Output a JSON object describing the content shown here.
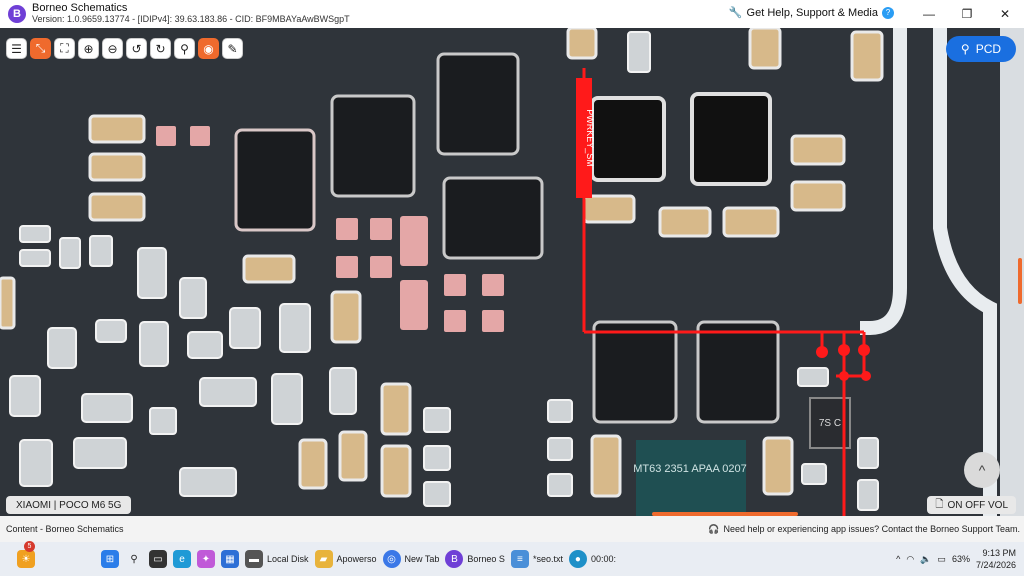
{
  "window": {
    "app_name": "Borneo Schematics",
    "version_line": "Version: 1.0.9659.13774 - [IDIPv4]: 39.63.183.86 - CID: BF9MBAYaAwBWSgpT",
    "help_link": "Get Help, Support & Media",
    "logo_letter": "B",
    "minimize": "—",
    "maximize": "❐",
    "close": "✕"
  },
  "toolbar": {
    "tools": [
      {
        "icon": "list-icon",
        "glyph": "☰"
      },
      {
        "icon": "collapse-icon",
        "glyph": "⤡"
      },
      {
        "icon": "fullscreen-icon",
        "glyph": "⛶"
      },
      {
        "icon": "zoom-in-icon",
        "glyph": "⊕"
      },
      {
        "icon": "zoom-out-icon",
        "glyph": "⊖"
      },
      {
        "icon": "rotate-left-icon",
        "glyph": "↺"
      },
      {
        "icon": "rotate-right-icon",
        "glyph": "↻"
      },
      {
        "icon": "search-icon",
        "glyph": "⚲"
      },
      {
        "icon": "mouse-icon",
        "glyph": "◉"
      },
      {
        "icon": "edit-icon",
        "glyph": "✎"
      }
    ]
  },
  "viewer": {
    "pcd_label": "PCD",
    "board_label": "XIAOMI | POCO M6 5G",
    "net_label": "PWRKEY_SM",
    "chip_label": "MT63 2351 APAA 0207",
    "chip_marking": "7S C",
    "vol_label": "ON OFF VOL",
    "scroll_up_glyph": "^"
  },
  "statusbar": {
    "left": "Content - Borneo Schematics",
    "right": "Need help or experiencing app issues? Contact the Borneo Support Team."
  },
  "taskbar": {
    "badge_count": "5",
    "items": [
      {
        "label": "Local Disk",
        "icon": "drive-icon",
        "color": "#555555"
      },
      {
        "label": "Apowerso",
        "icon": "folder-icon",
        "color": "#e8b33b"
      },
      {
        "label": "New Tab",
        "icon": "chrome-icon",
        "color": "#3b78e7"
      },
      {
        "label": "Borneo S",
        "icon": "borneo-icon",
        "color": "#6f3fd6"
      },
      {
        "label": "*seo.txt",
        "icon": "notepad-icon",
        "color": "#4a8fd8"
      },
      {
        "label": "00:00:",
        "icon": "recorder-icon",
        "color": "#1e90c8"
      }
    ],
    "battery": "63%",
    "time": "9:13 PM",
    "date": "7/24/2026"
  },
  "colors": {
    "accent": "#ef6a2d",
    "pcd": "#1a6fe0",
    "trace": "#ff1a1a",
    "board": "#2e3338"
  }
}
